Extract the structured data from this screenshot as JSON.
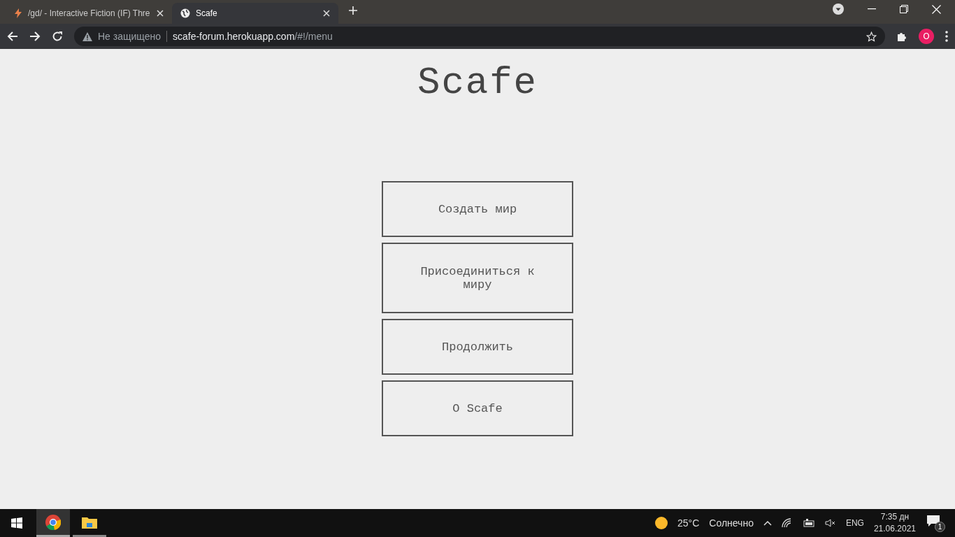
{
  "browser": {
    "tabs": [
      {
        "title": "/gd/ - Interactive Fiction (IF) Thre",
        "selected": false
      },
      {
        "title": "Scafe",
        "selected": true
      }
    ],
    "security": "Не защищено",
    "url_host": "scafe-forum.herokuapp.com",
    "url_path": "/#!/menu",
    "profile_initial": "O"
  },
  "page": {
    "title": "Scafe",
    "menu": [
      "Создать мир",
      "Присоединиться к миру",
      "Продолжить",
      "О Scafe"
    ]
  },
  "taskbar": {
    "apps": [
      {
        "kind": "chrome",
        "selected": true
      },
      {
        "kind": "folder",
        "selected": false
      }
    ],
    "weather": "25°C",
    "weather_text": "Солнечно",
    "language": "ENG",
    "time": "7:35 дн",
    "date": "21.06.2021",
    "notifications": "1"
  }
}
